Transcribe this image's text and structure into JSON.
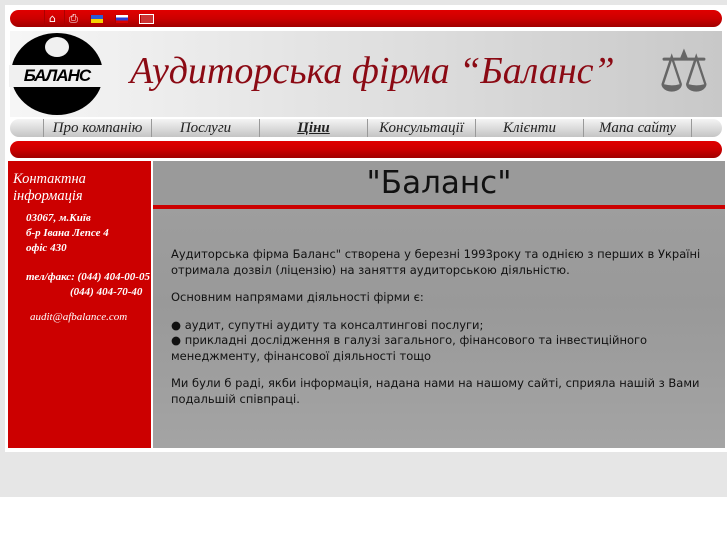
{
  "topbar": {
    "icons": [
      "home-icon",
      "print-icon",
      "flag-ua-icon",
      "flag-ru-icon",
      "flag-uk-icon"
    ]
  },
  "header": {
    "logo_text": "БАЛАНС",
    "title": "Аудиторська фірма “Баланс”"
  },
  "nav": [
    {
      "label": "Про компанію"
    },
    {
      "label": "Послуги"
    },
    {
      "label": "Ціни"
    },
    {
      "label": "Консультації"
    },
    {
      "label": "Клієнти"
    },
    {
      "label": "Мапа сайту"
    }
  ],
  "sidebar": {
    "heading": "Контактна інформація",
    "address": [
      "03067, м.Київ",
      "б-р Івана Лепсе 4",
      "офіс 430"
    ],
    "phone_label": "тел/факс:",
    "phones": [
      "(044) 404-00-05",
      "(044) 404-70-40"
    ],
    "email": "audit@afbalance.com"
  },
  "main": {
    "title": "\"Баланс\"",
    "p1": "Аудиторська фірма  Баланс\" створена у березні  1993року та однією з перших в Україні отримала дозвіл (ліцензію) на заняття аудиторською діяльністю.",
    "p2": "Основним напрямами діяльності фірми є:",
    "bullets": [
      "аудит, супутні аудиту та консалтингові послуги;",
      "прикладні дослідження в галузі загального, фінансового та інвестиційного менеджменту, фінансової діяльності тощо"
    ],
    "p3": "Ми були б раді, якби інформація, надана нами на нашому сайті, сприяла нашій з Вами подальшій співпраці."
  }
}
